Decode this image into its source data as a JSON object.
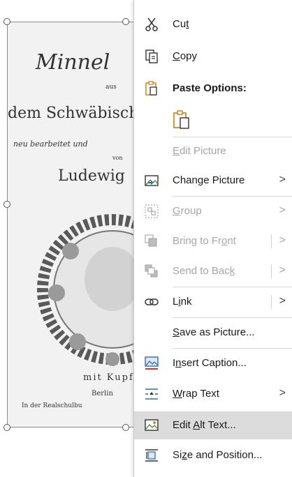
{
  "picture": {
    "lines": [
      "Minnel",
      "aus",
      "dem Schwäbisch",
      "neu bearbeitet und",
      "von",
      "Ludewig",
      "mit Kupf",
      "Berlin",
      "In der Realschulbu"
    ]
  },
  "menu": {
    "cut": {
      "pre": "Cu",
      "key": "t",
      "post": ""
    },
    "copy": {
      "pre": "",
      "key": "C",
      "post": "opy"
    },
    "paste_options": "Paste Options:",
    "edit_picture": {
      "pre": "",
      "key": "E",
      "post": "dit Picture"
    },
    "change_picture": {
      "pre": "Chan",
      "key": "g",
      "post": "e Picture"
    },
    "group": {
      "pre": "",
      "key": "G",
      "post": "roup"
    },
    "bring_to_front": {
      "pre": "Bring to Fr",
      "key": "o",
      "post": "nt"
    },
    "send_to_back": {
      "pre": "Send to Bac",
      "key": "k",
      "post": ""
    },
    "link": {
      "pre": "L",
      "key": "i",
      "post": "nk"
    },
    "save_as_picture": {
      "pre": "",
      "key": "S",
      "post": "ave as Picture..."
    },
    "insert_caption": {
      "pre": "I",
      "key": "n",
      "post": "sert Caption..."
    },
    "wrap_text": {
      "pre": "",
      "key": "W",
      "post": "rap Text"
    },
    "edit_alt_text": {
      "pre": "Edit ",
      "key": "A",
      "post": "lt Text..."
    },
    "size_and_position": {
      "pre": "Si",
      "key": "z",
      "post": "e and Position..."
    },
    "chevron": ">"
  },
  "colors": {
    "accent_orange": "#d98a1f",
    "accent_blue": "#2f6db5",
    "highlight": "#dcdcdc",
    "disabled_text": "#a6a6a6"
  }
}
